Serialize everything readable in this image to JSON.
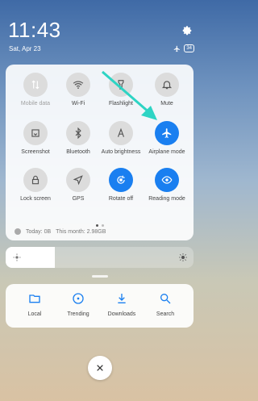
{
  "status_bar": {
    "time": "11:43",
    "date": "Sat, Apr 23",
    "battery": "34"
  },
  "tiles": [
    {
      "label": "Mobile data",
      "icon": "mobile-data-icon",
      "state": "disabled"
    },
    {
      "label": "Wi-Fi",
      "icon": "wifi-icon",
      "state": "off"
    },
    {
      "label": "Flashlight",
      "icon": "flashlight-icon",
      "state": "off"
    },
    {
      "label": "Mute",
      "icon": "bell-icon",
      "state": "off"
    },
    {
      "label": "Screenshot",
      "icon": "screenshot-icon",
      "state": "off"
    },
    {
      "label": "Bluetooth",
      "icon": "bluetooth-icon",
      "state": "off"
    },
    {
      "label": "Auto brightness",
      "icon": "auto-brightness-icon",
      "state": "off"
    },
    {
      "label": "Airplane mode",
      "icon": "airplane-icon",
      "state": "on"
    },
    {
      "label": "Lock screen",
      "icon": "lock-icon",
      "state": "off"
    },
    {
      "label": "GPS",
      "icon": "gps-icon",
      "state": "off"
    },
    {
      "label": "Rotate off",
      "icon": "rotate-icon",
      "state": "on"
    },
    {
      "label": "Reading mode",
      "icon": "eye-icon",
      "state": "on"
    }
  ],
  "data_usage": {
    "today": "Today: 0B",
    "month": "This month: 2.98GB"
  },
  "brightness": {
    "level": 0.26
  },
  "shortcuts": [
    {
      "label": "Local",
      "icon": "folder-icon"
    },
    {
      "label": "Trending",
      "icon": "trending-icon"
    },
    {
      "label": "Downloads",
      "icon": "download-icon"
    },
    {
      "label": "Search",
      "icon": "search-icon"
    }
  ],
  "colors": {
    "accent": "#1a7ff0",
    "annotation_arrow": "#2dd4c4"
  }
}
